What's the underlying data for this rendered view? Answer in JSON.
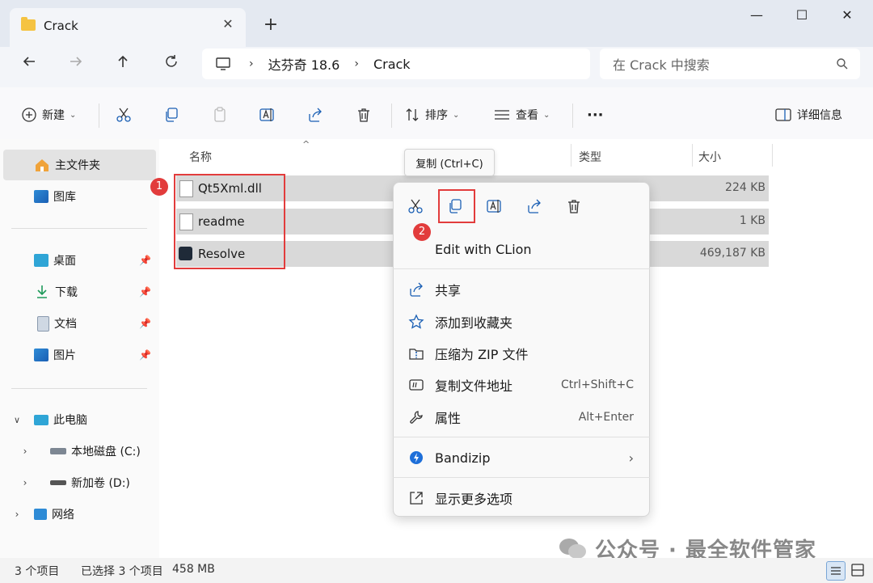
{
  "window": {
    "tab_title": "Crack",
    "tab_close": "✕",
    "new_tab": "+",
    "minimize": "—",
    "maximize": "☐",
    "close": "✕"
  },
  "nav": {
    "breadcrumb": [
      "达芬奇 18.6",
      "Crack"
    ],
    "search_placeholder": "在 Crack 中搜索"
  },
  "toolbar": {
    "new_label": "新建",
    "sort_label": "排序",
    "view_label": "查看",
    "more_label": "···",
    "details_label": "详细信息"
  },
  "sidebar": {
    "home": "主文件夹",
    "gallery": "图库",
    "quick": [
      {
        "label": "桌面"
      },
      {
        "label": "下载"
      },
      {
        "label": "文档"
      },
      {
        "label": "图片"
      }
    ],
    "this_pc": "此电脑",
    "drives": [
      {
        "label": "本地磁盘 (C:)"
      },
      {
        "label": "新加卷 (D:)"
      }
    ],
    "network": "网络"
  },
  "columns": {
    "name": "名称",
    "type": "类型",
    "size": "大小"
  },
  "files": [
    {
      "name": "Qt5Xml.dll",
      "size": "224 KB",
      "icon": "dll-file-icon"
    },
    {
      "name": "readme",
      "size": "1 KB",
      "icon": "text-file-icon"
    },
    {
      "name": "Resolve",
      "size": "469,187 KB",
      "icon": "resolve-app-icon"
    }
  ],
  "tooltip": "复制 (Ctrl+C)",
  "context_menu": {
    "edit_with": "Edit with CLion",
    "items": [
      {
        "label": "共享",
        "shortcut": ""
      },
      {
        "label": "添加到收藏夹",
        "shortcut": ""
      },
      {
        "label": "压缩为 ZIP 文件",
        "shortcut": ""
      },
      {
        "label": "复制文件地址",
        "shortcut": "Ctrl+Shift+C"
      },
      {
        "label": "属性",
        "shortcut": "Alt+Enter"
      }
    ],
    "bandizip": "Bandizip",
    "more_options": "显示更多选项"
  },
  "annotations": {
    "badge1": "1",
    "badge2": "2"
  },
  "status": {
    "count": "3 个项目",
    "selected": "已选择 3 个项目",
    "size": "458 MB"
  },
  "watermark": "公众号 · 最全软件管家",
  "colors": {
    "accent": "#0067c0",
    "annotation": "#e23c3c"
  }
}
